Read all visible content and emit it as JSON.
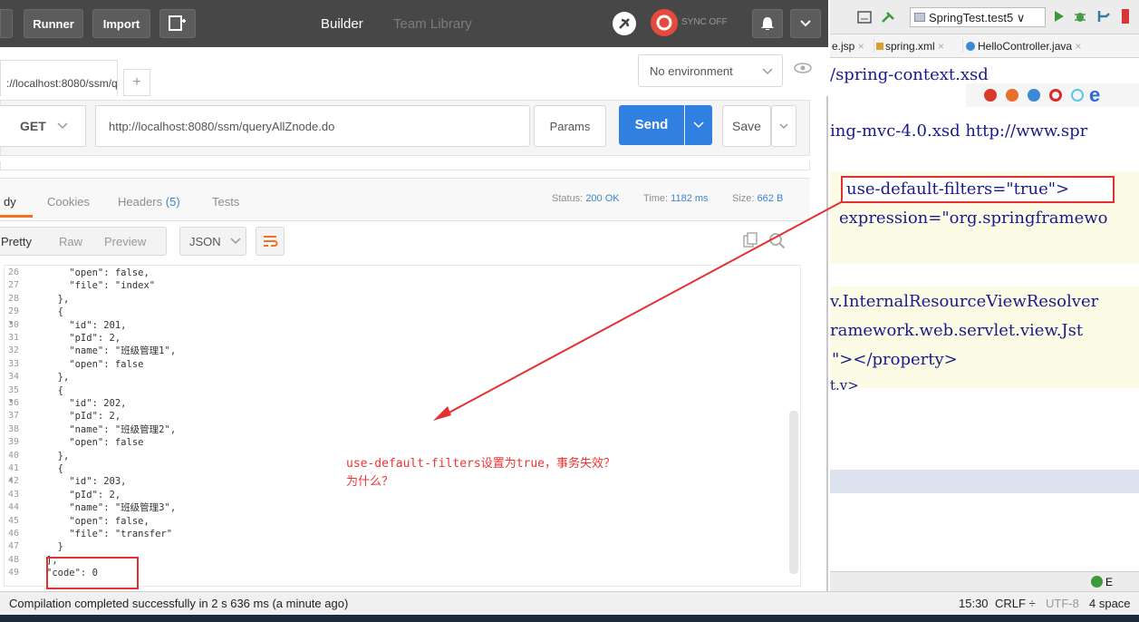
{
  "postman": {
    "toolbar": {
      "runner": "Runner",
      "import": "Import",
      "tab_builder": "Builder",
      "tab_team": "Team Library",
      "sync": "SYNC OFF"
    },
    "url_tab": "://localhost:8080/ssm/q",
    "add_tab": "+",
    "environment": "No environment",
    "request": {
      "method": "GET",
      "url": "http://localhost:8080/ssm/queryAllZnode.do",
      "params": "Params",
      "send": "Send",
      "save": "Save"
    },
    "response_tabs": {
      "body": "dy",
      "cookies": "Cookies",
      "headers": "Headers",
      "headers_count": "(5)",
      "tests": "Tests"
    },
    "status": {
      "status_label": "Status:",
      "status_value": "200 OK",
      "time_label": "Time:",
      "time_value": "1182 ms",
      "size_label": "Size:",
      "size_value": "662 B"
    },
    "view": {
      "pretty": "Pretty",
      "raw": "Raw",
      "preview": "Preview",
      "format": "JSON"
    },
    "code_lines": [
      {
        "n": "26",
        "t": "    \"open\": false,"
      },
      {
        "n": "27",
        "t": "    \"file\": \"index\""
      },
      {
        "n": "28",
        "t": "  },"
      },
      {
        "n": "29 ▾",
        "t": "  {"
      },
      {
        "n": "30",
        "t": "    \"id\": 201,"
      },
      {
        "n": "31",
        "t": "    \"pId\": 2,"
      },
      {
        "n": "32",
        "t": "    \"name\": \"班级管理1\","
      },
      {
        "n": "33",
        "t": "    \"open\": false"
      },
      {
        "n": "34",
        "t": "  },"
      },
      {
        "n": "35 ▾",
        "t": "  {"
      },
      {
        "n": "36",
        "t": "    \"id\": 202,"
      },
      {
        "n": "37",
        "t": "    \"pId\": 2,"
      },
      {
        "n": "38",
        "t": "    \"name\": \"班级管理2\","
      },
      {
        "n": "39",
        "t": "    \"open\": false"
      },
      {
        "n": "40",
        "t": "  },"
      },
      {
        "n": "41 ▾",
        "t": "  {"
      },
      {
        "n": "42",
        "t": "    \"id\": 203,"
      },
      {
        "n": "43",
        "t": "    \"pId\": 2,"
      },
      {
        "n": "44",
        "t": "    \"name\": \"班级管理3\","
      },
      {
        "n": "45",
        "t": "    \"open\": false,"
      },
      {
        "n": "46",
        "t": "    \"file\": \"transfer\""
      },
      {
        "n": "47",
        "t": "  }"
      },
      {
        "n": "48",
        "t": "],"
      },
      {
        "n": "49",
        "t": "\"code\": 0"
      }
    ],
    "annotation_line1": "use-default-filters设置为true，事务失效？",
    "annotation_line2": "为什么？"
  },
  "ide": {
    "run_config": "SpringTest.test5",
    "tabs": [
      {
        "label": "e.jsp"
      },
      {
        "label": "spring.xml"
      },
      {
        "label": "HelloController.java"
      }
    ],
    "lines": [
      "/spring-context.xsd",
      "ing-mvc-4.0.xsd http://www.spr",
      "use-default-filters=\"true\">",
      "expression=\"org.springframewo",
      "v.InternalResourceViewResolver",
      "ramework.web.servlet.view.Jst",
      "\"></property>",
      "t.v>"
    ],
    "event_log": "E"
  },
  "statusbar": {
    "message": "Compilation completed successfully in 2 s 636 ms (a minute ago)",
    "position": "15:30",
    "crlf": "CRLF ÷",
    "encoding": "UTF-8",
    "indent": "4 space"
  },
  "colors": {
    "send": "#2f80e0",
    "annotation": "#e53030",
    "status_ok": "#3b86ca"
  }
}
